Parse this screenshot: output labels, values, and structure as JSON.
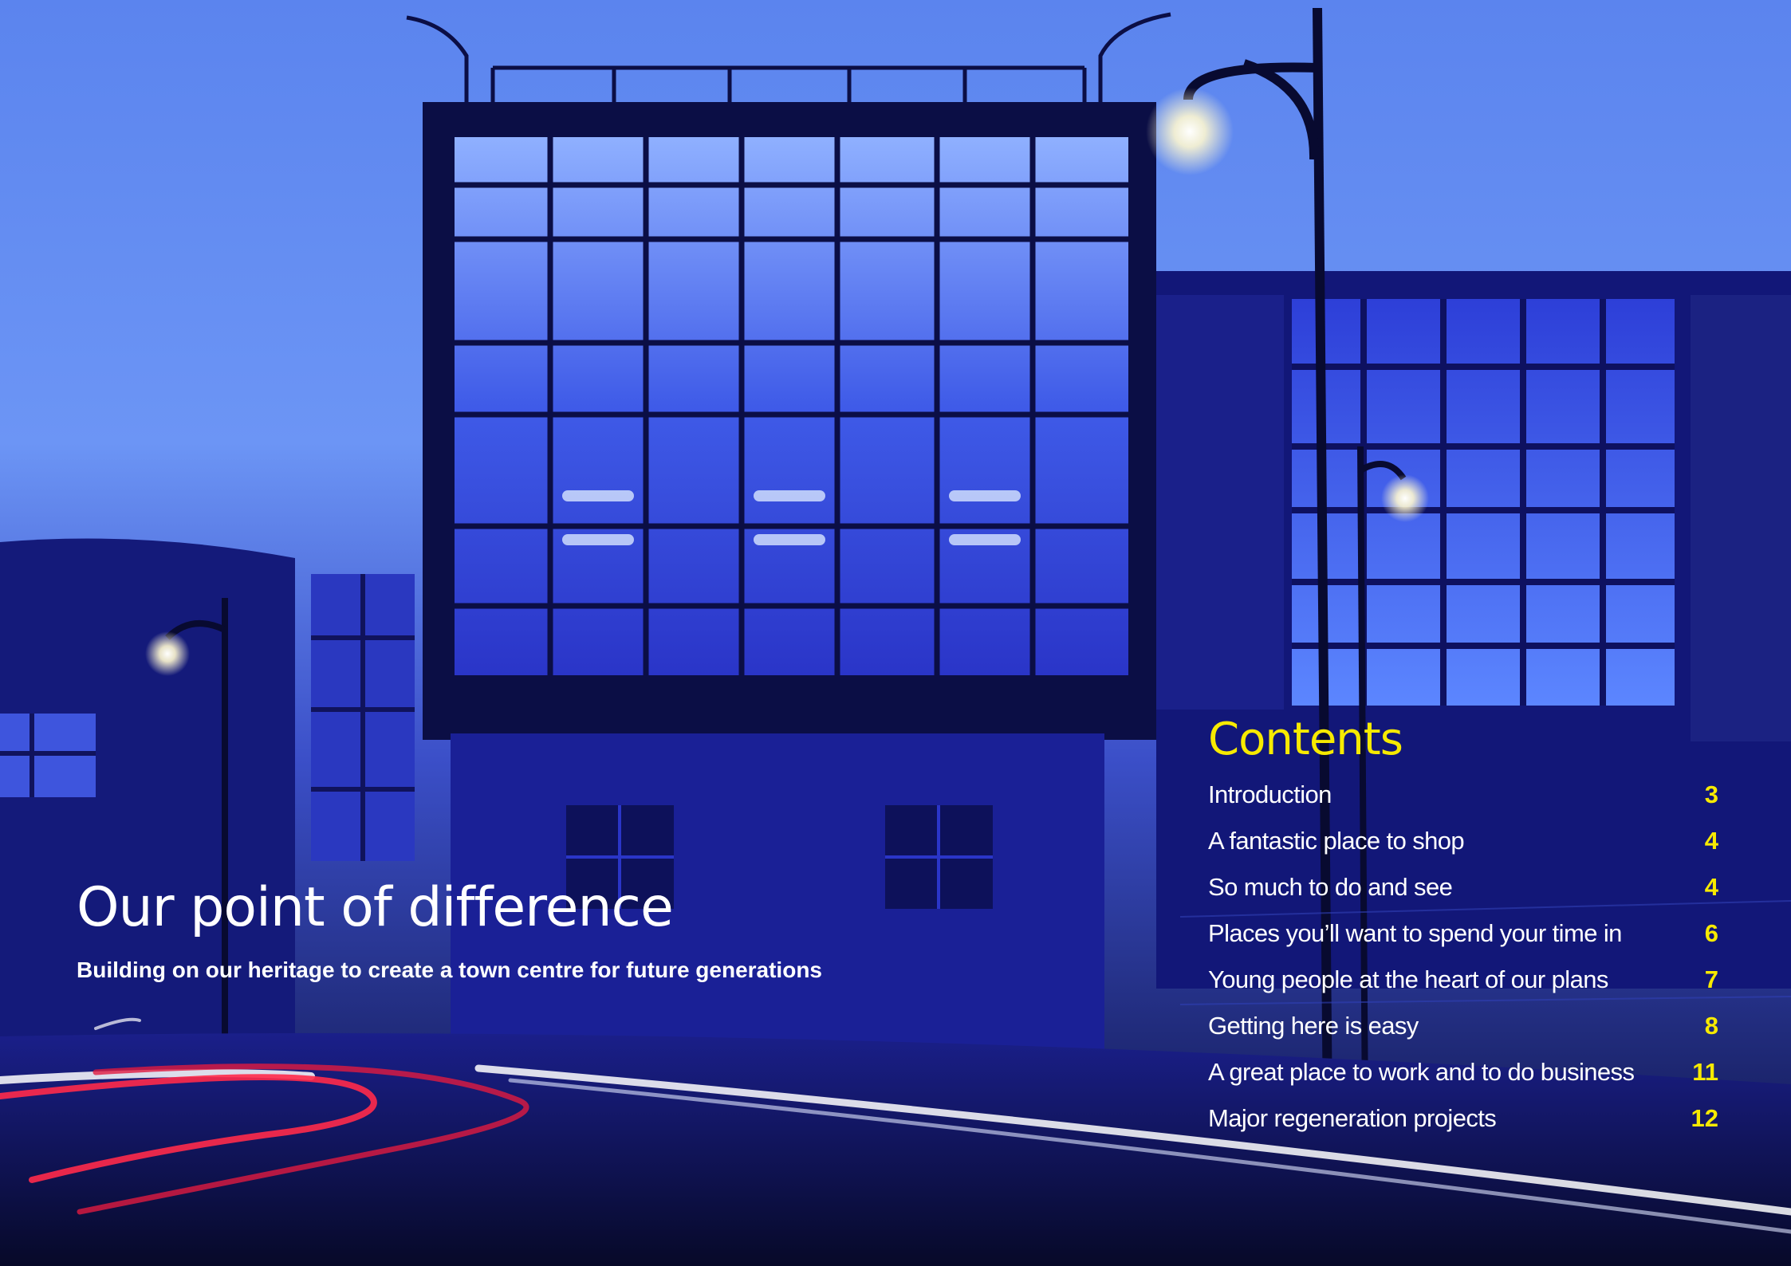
{
  "hero": {
    "title": "Our point of difference",
    "subtitle": "Building on our heritage to create a town centre for future generations"
  },
  "contents": {
    "heading": "Contents",
    "items": [
      {
        "label": "Introduction",
        "page": "3"
      },
      {
        "label": "A fantastic place to shop",
        "page": "4"
      },
      {
        "label": "So much to do and see",
        "page": "4"
      },
      {
        "label": "Places you’ll want to spend your time in",
        "page": "6"
      },
      {
        "label": "Young people at the heart of our plans",
        "page": "7"
      },
      {
        "label": "Getting here is easy",
        "page": "8"
      },
      {
        "label": "A great place to work and to do business",
        "page": "11"
      },
      {
        "label": "Major regeneration projects",
        "page": "12"
      }
    ]
  },
  "colors": {
    "accent": "#f7ea00",
    "text": "#ffffff",
    "sky_top": "#5e87f0",
    "night_blue": "#12177a"
  }
}
